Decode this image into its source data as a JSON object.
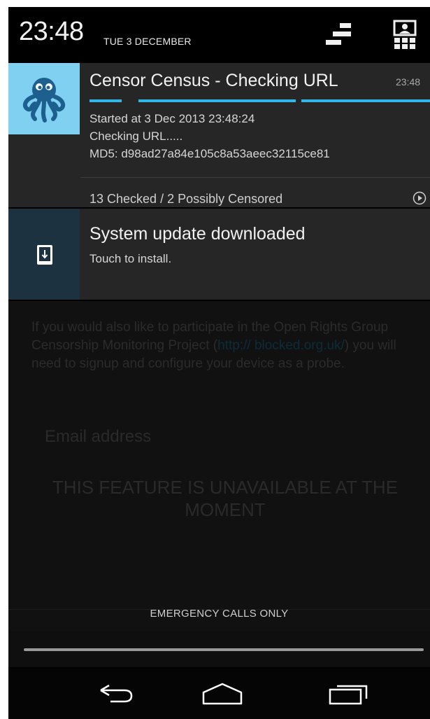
{
  "status_bar": {
    "time": "23:48",
    "date": "TUE 3 DECEMBER"
  },
  "notifications": [
    {
      "app_icon": "octopus-icon",
      "title": "Censor Census - Checking URL",
      "time": "23:48",
      "progress_indeterminate": true,
      "lines": [
        "Started at 3 Dec 2013 23:48:24",
        "Checking URL.....",
        "MD5: d98ad27a84e105c8a53aeec32115ce81"
      ],
      "action_label": "13 Checked / 2 Possibly Censored",
      "action_icon": "play-circle-icon"
    },
    {
      "app_icon": "system-update-icon",
      "title": "System update downloaded",
      "subtitle": "Touch to install."
    }
  ],
  "background_app": {
    "paragraph_before": "If you would also like to participate in the Open Rights Group Censorship Monitoring Project (",
    "link": "http:// blocked.org.uk/",
    "paragraph_after": ") you will need to signup and configure your device as a probe.",
    "email_placeholder": "Email address",
    "notice": "THIS FEATURE IS UNAVAILABLE AT THE MOMENT"
  },
  "shade": {
    "carrier_text": "EMERGENCY CALLS ONLY"
  },
  "nav_bar": {
    "buttons": [
      "back-icon",
      "home-icon",
      "recents-icon"
    ]
  },
  "colors": {
    "accent": "#33b5e5",
    "app_icon_bg": "#80d0f2",
    "update_icon_bg": "#1d3240"
  }
}
